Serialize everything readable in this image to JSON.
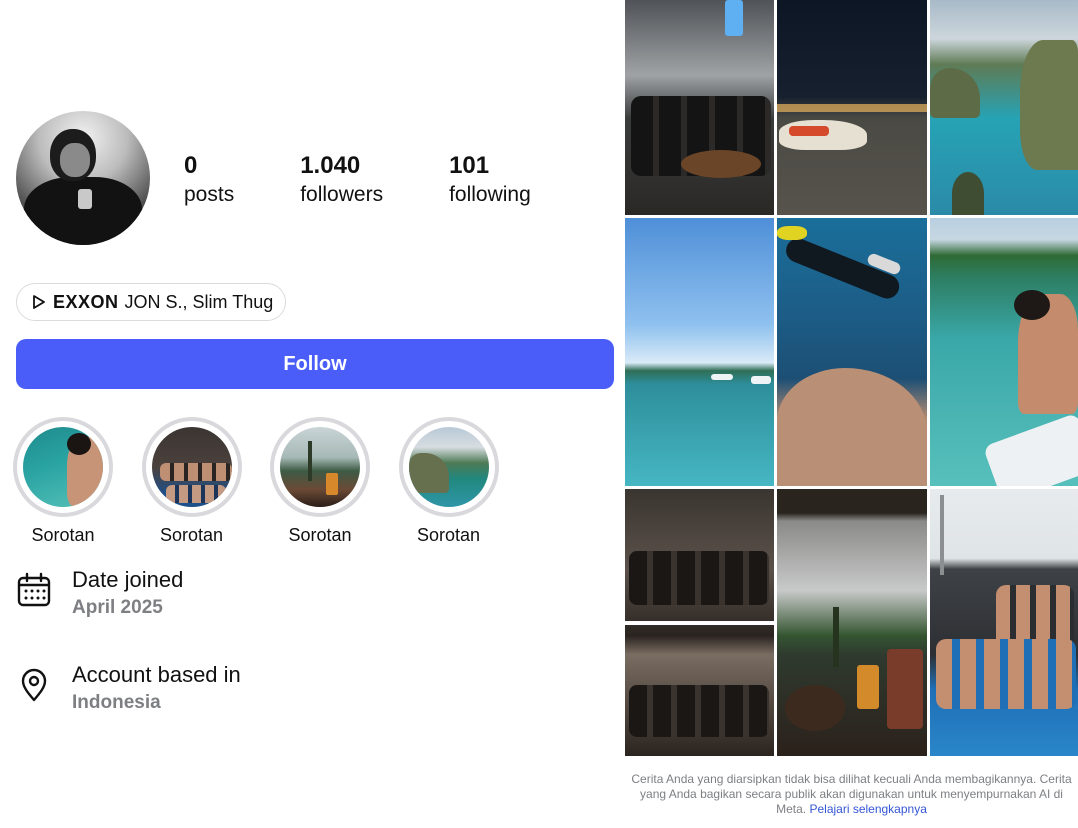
{
  "profile": {
    "stats": [
      {
        "value": "0",
        "label": "posts"
      },
      {
        "value": "1.040",
        "label": "followers"
      },
      {
        "value": "101",
        "label": "following"
      }
    ],
    "music": {
      "icon": "play-icon",
      "artist": "EXXON",
      "rest": "JON S., Slim Thug"
    },
    "follow_label": "Follow",
    "highlights": [
      {
        "label": "Sorotan"
      },
      {
        "label": "Sorotan"
      },
      {
        "label": "Sorotan"
      },
      {
        "label": "Sorotan"
      }
    ],
    "about": [
      {
        "icon": "calendar-icon",
        "title": "Date joined",
        "value": "April 2025"
      },
      {
        "icon": "location-pin-icon",
        "title": "Account based in",
        "value": "Indonesia"
      }
    ]
  },
  "grid": {
    "tile_count": 9,
    "caption_text": "Cerita Anda yang diarsipkan tidak bisa dilihat kecuali Anda membagikannya. Cerita yang Anda bagikan secara publik akan digunakan untuk menyempurnakan AI di Meta.",
    "caption_link": "Pelajari selengkapnya"
  },
  "colors": {
    "accent": "#4a5df9",
    "secondary_text": "#7d7f83",
    "link": "#3457d5"
  }
}
